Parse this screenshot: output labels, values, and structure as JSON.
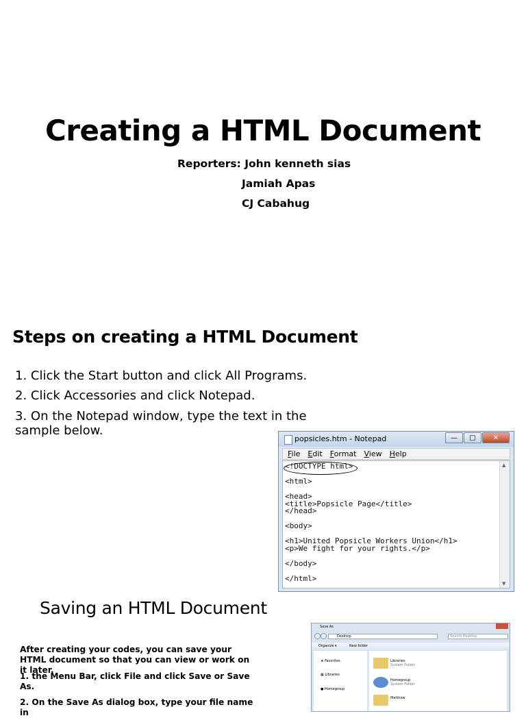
{
  "title": "Creating a HTML Document",
  "reporters": {
    "line1": "Reporters: John kenneth sias",
    "line2": "Jamiah Apas",
    "line3": "CJ Cabahug"
  },
  "steps": {
    "heading": "Steps on creating a HTML Document",
    "items": [
      "1. Click the Start button and click All Programs.",
      "2. Click Accessories and click Notepad.",
      "3. On the Notepad window, type the text in the sample below."
    ]
  },
  "notepad": {
    "title": "popsicles.htm - Notepad",
    "menu": [
      "File",
      "Edit",
      "Format",
      "View",
      "Help"
    ],
    "code": "<!DOCTYPE html>\n\n<html>\n\n<head>\n<title>Popsicle Page</title>\n</head>\n\n<body>\n\n<h1>United Popsicle Workers Union</h1>\n<p>We fight for your rights.</p>\n\n</body>\n\n</html>"
  },
  "saving": {
    "heading": "Saving an HTML Document",
    "para1": "After creating your codes, you can save your HTML document so that you can view or work on it later.",
    "para2": "1.  the Menu Bar, click File and click Save or Save As.",
    "para3": "2. On the Save As dialog box, type your file name in"
  },
  "save_as_dialog": {
    "title": "Save As",
    "address": "Desktop",
    "search_placeholder": "Search Desktop",
    "organize": "Organize ▾",
    "new_folder": "New folder",
    "nav": [
      "Favorites",
      "Libraries",
      "Homegroup"
    ],
    "items": [
      {
        "name": "Libraries",
        "sub": "System Folder"
      },
      {
        "name": "Homegroup",
        "sub": "System Folder"
      },
      {
        "name": "Matthew",
        "sub": ""
      }
    ]
  }
}
